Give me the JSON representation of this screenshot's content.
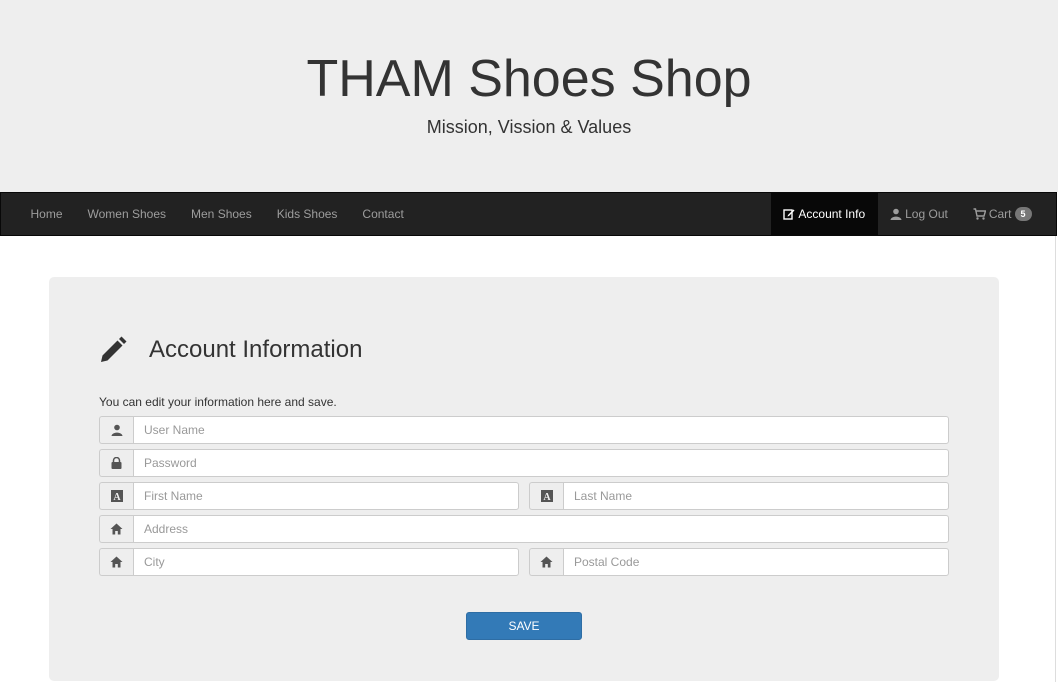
{
  "header": {
    "title": "THAM Shoes Shop",
    "subtitle": "Mission, Vission & Values"
  },
  "nav": {
    "left": [
      "Home",
      "Women Shoes",
      "Men Shoes",
      "Kids Shoes",
      "Contact"
    ],
    "account": "Account Info",
    "logout": "Log Out",
    "cart": "Cart",
    "cart_count": "5"
  },
  "form": {
    "title": "Account Information",
    "intro": "You can edit your information here and save.",
    "username_placeholder": "User Name",
    "password_placeholder": "Password",
    "firstname_placeholder": "First Name",
    "lastname_placeholder": "Last Name",
    "address_placeholder": "Address",
    "city_placeholder": "City",
    "postal_placeholder": "Postal Code",
    "save_label": "SAVE"
  },
  "icons": {
    "title": "pencil-icon",
    "username": "user-icon",
    "password": "lock-icon",
    "firstname": "font-icon",
    "lastname": "font-icon",
    "address": "home-icon",
    "city": "home-icon",
    "postal": "home-icon",
    "account": "edit-icon",
    "logout": "user-icon",
    "cart": "cart-icon"
  },
  "colors": {
    "navbar": "#222222",
    "active_nav": "#080808",
    "primary_button": "#337ab7",
    "panel": "#eeeeee"
  }
}
